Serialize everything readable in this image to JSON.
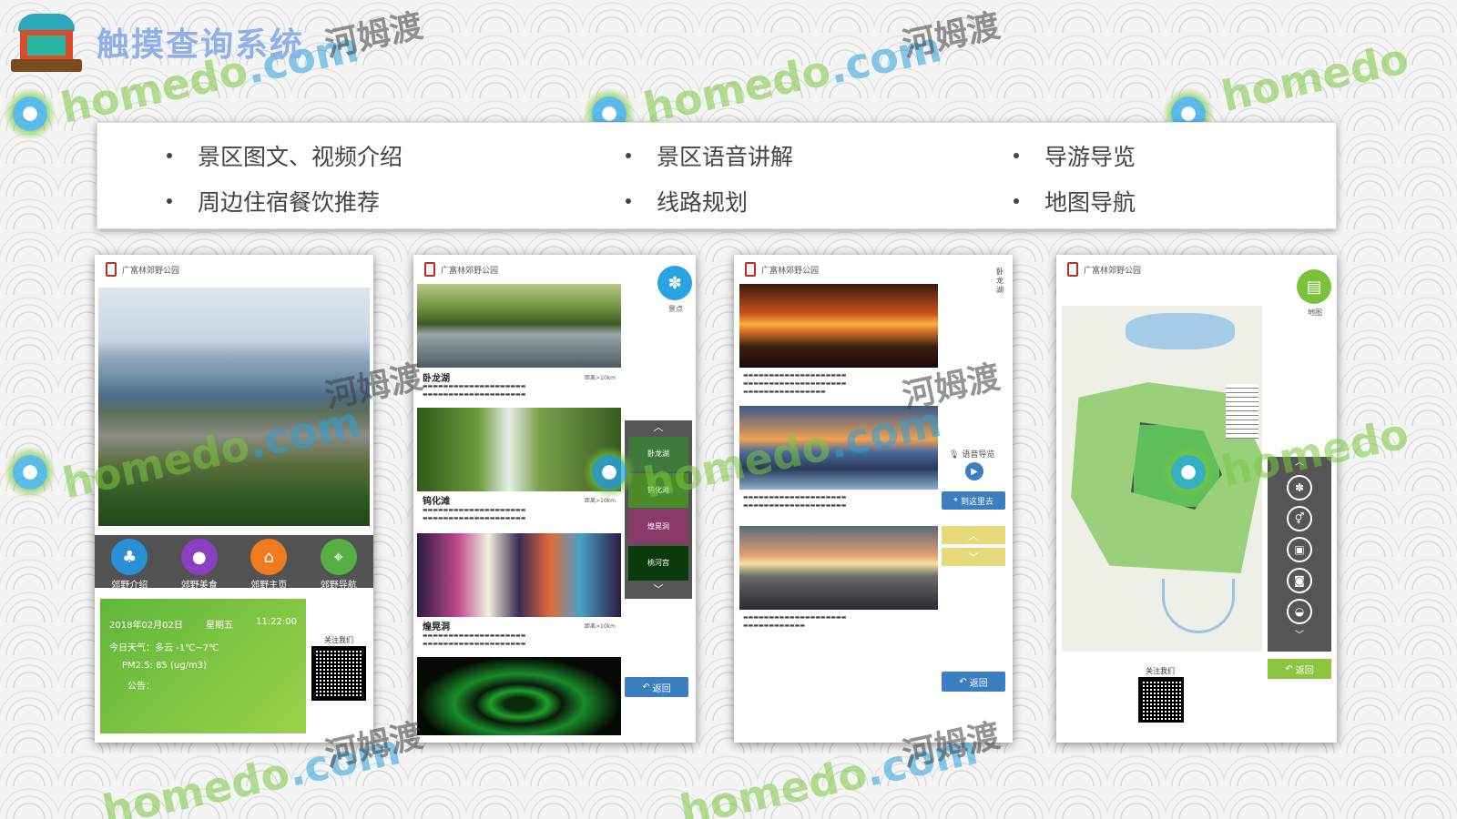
{
  "app": {
    "title": "触摸查询系统"
  },
  "watermark": {
    "en_a": "homedo",
    "en_b": ".com",
    "cn": "河姆渡"
  },
  "features": [
    "景区图文、视频介绍",
    "景区语音讲解",
    "导游导览",
    "周边住宿餐饮推荐",
    "线路规划",
    "地图导航"
  ],
  "screens": {
    "home": {
      "park_name": "广富林郊野公园",
      "nav": [
        "郊野介绍",
        "郊野美食",
        "郊野主页",
        "郊野导航"
      ],
      "info": {
        "date": "2018年02月02日",
        "weekday": "星期五",
        "time": "11:22:00",
        "weather": "今日天气：多云 -1℃~7℃",
        "pm": "PM2.5:  85 (ug/m3)",
        "notice_label": "公告："
      },
      "follow": "关注我们"
    },
    "scenic": {
      "park_name": "广富林郊野公园",
      "side_label": "景点",
      "spots": [
        {
          "name": "卧龙湖",
          "dist": "距离>10km"
        },
        {
          "name": "钨化滩",
          "dist": "距离>10km"
        },
        {
          "name": "煌晃洞",
          "dist": "距离>10km"
        }
      ],
      "thumbs": [
        "卧龙湖",
        "钨化滩",
        "煌晃洞",
        "桃河宫"
      ],
      "back": "返回"
    },
    "audio": {
      "park_name": "广富林郊野公园",
      "vertical_title": "卧龙湖",
      "audio_label": "语音导览",
      "nearby": "到这里去",
      "back": "返回"
    },
    "map": {
      "park_name": "广富林郊野公园",
      "side_label": "地图",
      "follow": "关注我们",
      "back": "返回"
    }
  },
  "colors": {
    "accent_blue": "#3b7fc1",
    "accent_green": "#8cc63f",
    "info_green": "#6dbb3f"
  }
}
